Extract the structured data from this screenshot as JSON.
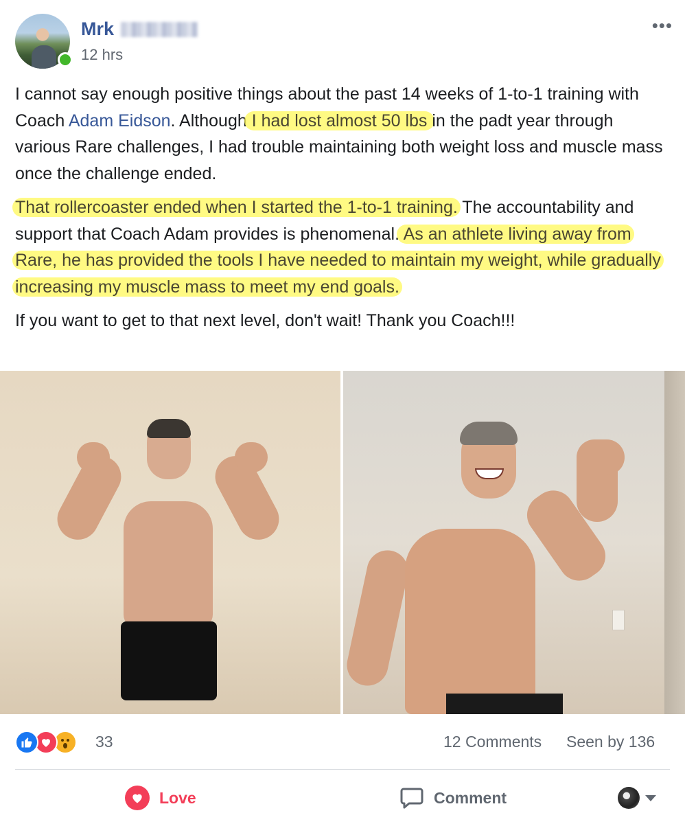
{
  "post": {
    "author": "Mrk",
    "timestamp": "12 hrs",
    "more_label": "•••",
    "paragraphs": {
      "p1": {
        "t1": "I cannot say enough positive things about the past 14 weeks of 1-to-1 training with Coach ",
        "link": "Adam Eidson",
        "t2": ". Although",
        "hl": " I had lost almost 50 lbs ",
        "t3": "in the padt year through various Rare challenges, I had trouble maintaining both weight loss and muscle mass once the challenge ended."
      },
      "p2": {
        "hl1": "That rollercoaster ended when I started the 1-to-1 training.",
        "t1": " The accountability and support that Coach Adam provides is phenomenal.",
        "hl2": " As an athlete living away from Rare, he has provided the tools I have needed to maintain my weight, while gradually increasing my muscle mass to meet my end goals."
      },
      "p3": "If you want to get to that next level, don't wait! Thank you Coach!!!"
    }
  },
  "stats": {
    "reactions": [
      "like",
      "love",
      "wow"
    ],
    "reaction_count": "33",
    "comments": "12 Comments",
    "seen_by": "Seen by 136"
  },
  "actions": {
    "love_label": "Love",
    "comment_label": "Comment"
  },
  "colors": {
    "link": "#385898",
    "highlight": "#fff85a",
    "love": "#f33e58",
    "online": "#42b72a"
  }
}
